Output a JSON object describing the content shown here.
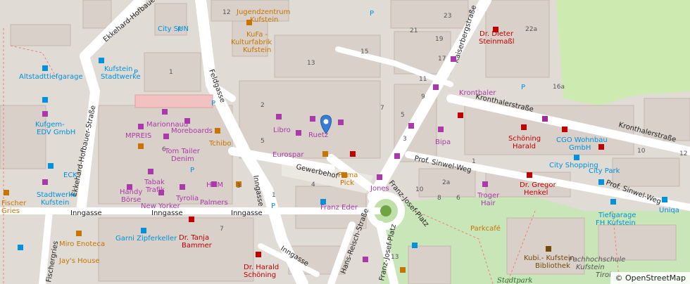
{
  "attribution": "© OpenStreetMap",
  "streets": {
    "ekkehard_hofbauer_1": "Ekkehard-Hofbauer-Straße",
    "ekkehard_hofbauer_2": "Ekkehard-Hofbauer-Straße",
    "feldgasse": "Feldgasse",
    "kaiserbergstrasse": "Kaiserbergstraße",
    "kronthalerstrasse_1": "Kronthalerstraße",
    "kronthalerstrasse_2": "Kronthalerstraße",
    "gewerbehof": "Gewerbehof",
    "inngasse_1": "Inngasse",
    "inngasse_2": "Inngasse",
    "inngasse_3": "Inngasse",
    "inngasse_v": "Inngasse",
    "inngasse_s": "Inngasse",
    "franz_josef_platz_1": "Franz-Josef-Platz",
    "franz_josef_platz_2": "Franz-Josef-Platz",
    "prof_sinwel_weg_1": "Prof. Sinwel-Weg",
    "prof_sinwel_weg_2": "Prof. Sinwel-Weg",
    "hans_reisch_strasse": "Hans-Reisch-Straße",
    "fischergries": "Fischergries"
  },
  "places": {
    "city_sun": "City SUN",
    "jugendzentrum": "Jugendzentrum",
    "kufstein_jz": "Kufstein",
    "kufa": "KuFa -",
    "kulturfabrik": "Kulturfabrik",
    "kufstein_kf": "Kufstein",
    "dr_dieter": "Dr. Dieter",
    "steinmassl": "Steinmaßl",
    "altstadttiefgarage": "Altstadttiefgarage",
    "kufstein_sw": "Kufstein",
    "stadtwerke": "Stadtwerke",
    "kufgem": "Kufgem-",
    "edv_gmbh": "EDV GmbH",
    "eck": "ECK",
    "stadtwerke2": "Stadtwerke",
    "kufstein_sw2": "Kufstein",
    "fischer": "Fischer",
    "gries": "Gries",
    "marionnaud": "Marionnaud",
    "moreboards": "Moreboards",
    "mpreis": "MPREIS",
    "tchibo": "Tchibo",
    "tom_tailer": "Tom Tailer",
    "denim": "Denim",
    "handy": "Handy",
    "boerse": "Börse",
    "tabak": "Tabak",
    "trafik": "Trafik",
    "hm": "H&M",
    "tyrolia": "Tyrolia",
    "palmers": "Palmers",
    "new_yorker": "New Yorker",
    "libro": "Libro",
    "ruetz": "Ruetz",
    "eurospar": "Eurospar",
    "kronthaler": "Kronthaler",
    "bipa": "Bipa",
    "schoening": "Schöning",
    "harald": "Harald",
    "cgo": "CGO Wohnbau",
    "gmbh": "GmbH",
    "city_shopping": "City Shopping",
    "city_park": "City Park",
    "pirma": "Pirma",
    "pick": "Pick",
    "jones": "Jones",
    "franz_eder": "Franz Eder",
    "troger": "Troger",
    "hair": "Hair",
    "dr_gregor": "Dr. Gregor",
    "henkel": "Henkel",
    "parkcafe": "Parkcafé",
    "tiefgarage": "Tiefgarage",
    "fh_kufstein": "FH Kufstein",
    "uniqa": "Uniqa",
    "garni": "Garni Zipferkeller",
    "dr_tanja": "Dr. Tanja",
    "bammer": "Bammer",
    "miro": "Miro Enoteca",
    "jays_house": "Jay's House",
    "dr_harald": "Dr. Harald",
    "schoening2": "Schöning",
    "kubi": "Kubi.- Kufstein",
    "bibliothek": "Bibliothek",
    "fachhochschule": "Fachhochschule",
    "kufstein_fh": "Kufstein",
    "tirol": "Tirol",
    "stadtpark": "Stadtpark"
  },
  "numbers": [
    "12",
    "15",
    "13",
    "23",
    "21",
    "19",
    "17",
    "22a",
    "16a",
    "11",
    "9",
    "7",
    "5",
    "3",
    "1",
    "2",
    "5",
    "6",
    "4",
    "3",
    "1",
    "7",
    "2a",
    "10",
    "8",
    "6",
    "1",
    "10",
    "12",
    "13"
  ],
  "colors": {
    "shop": "#ac39ac",
    "amenity": "#0092da",
    "food": "#c77400",
    "health": "#bf0000"
  }
}
